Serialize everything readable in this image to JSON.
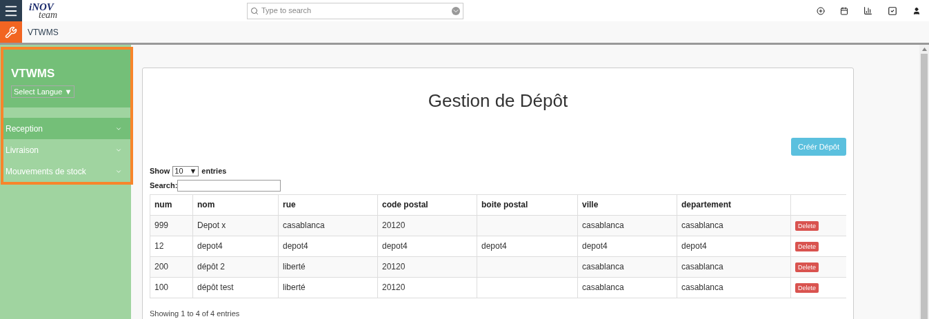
{
  "logo": {
    "top": "iNOV",
    "bottom": "team"
  },
  "search": {
    "placeholder": "Type to search"
  },
  "breadcrumb": "VTWMS",
  "sidebar": {
    "title": "VTWMS",
    "language_select": "Select Langue ▼",
    "items": [
      {
        "label": "Reception",
        "selected": true
      },
      {
        "label": "Livraison",
        "selected": false
      },
      {
        "label": "Mouvements de stock",
        "selected": false
      }
    ]
  },
  "page": {
    "title": "Gestion de Dépôt",
    "create_button": "Créér Dépôt",
    "show_label": "Show",
    "page_size": "10",
    "page_size_arrow": "▼",
    "entries_label": "entries",
    "search_label": "Search:",
    "footer": "Showing 1 to 4 of 4 entries"
  },
  "table": {
    "columns": [
      "num",
      "nom",
      "rue",
      "code postal",
      "boite postal",
      "ville",
      "departement"
    ],
    "rows": [
      {
        "cells": [
          "999",
          "Depot x",
          "casablanca",
          "20120",
          "",
          "casablanca",
          "casablanca"
        ],
        "action": "Delete"
      },
      {
        "cells": [
          "12",
          "depot4",
          "depot4",
          "depot4",
          "depot4",
          "depot4",
          "depot4"
        ],
        "action": "Delete"
      },
      {
        "cells": [
          "200",
          "dépôt 2",
          "liberté",
          "20120",
          "",
          "casablanca",
          "casablanca"
        ],
        "action": "Delete"
      },
      {
        "cells": [
          "100",
          "dépôt test",
          "liberté",
          "20120",
          "",
          "casablanca",
          "casablanca"
        ],
        "action": "Delete"
      }
    ]
  }
}
